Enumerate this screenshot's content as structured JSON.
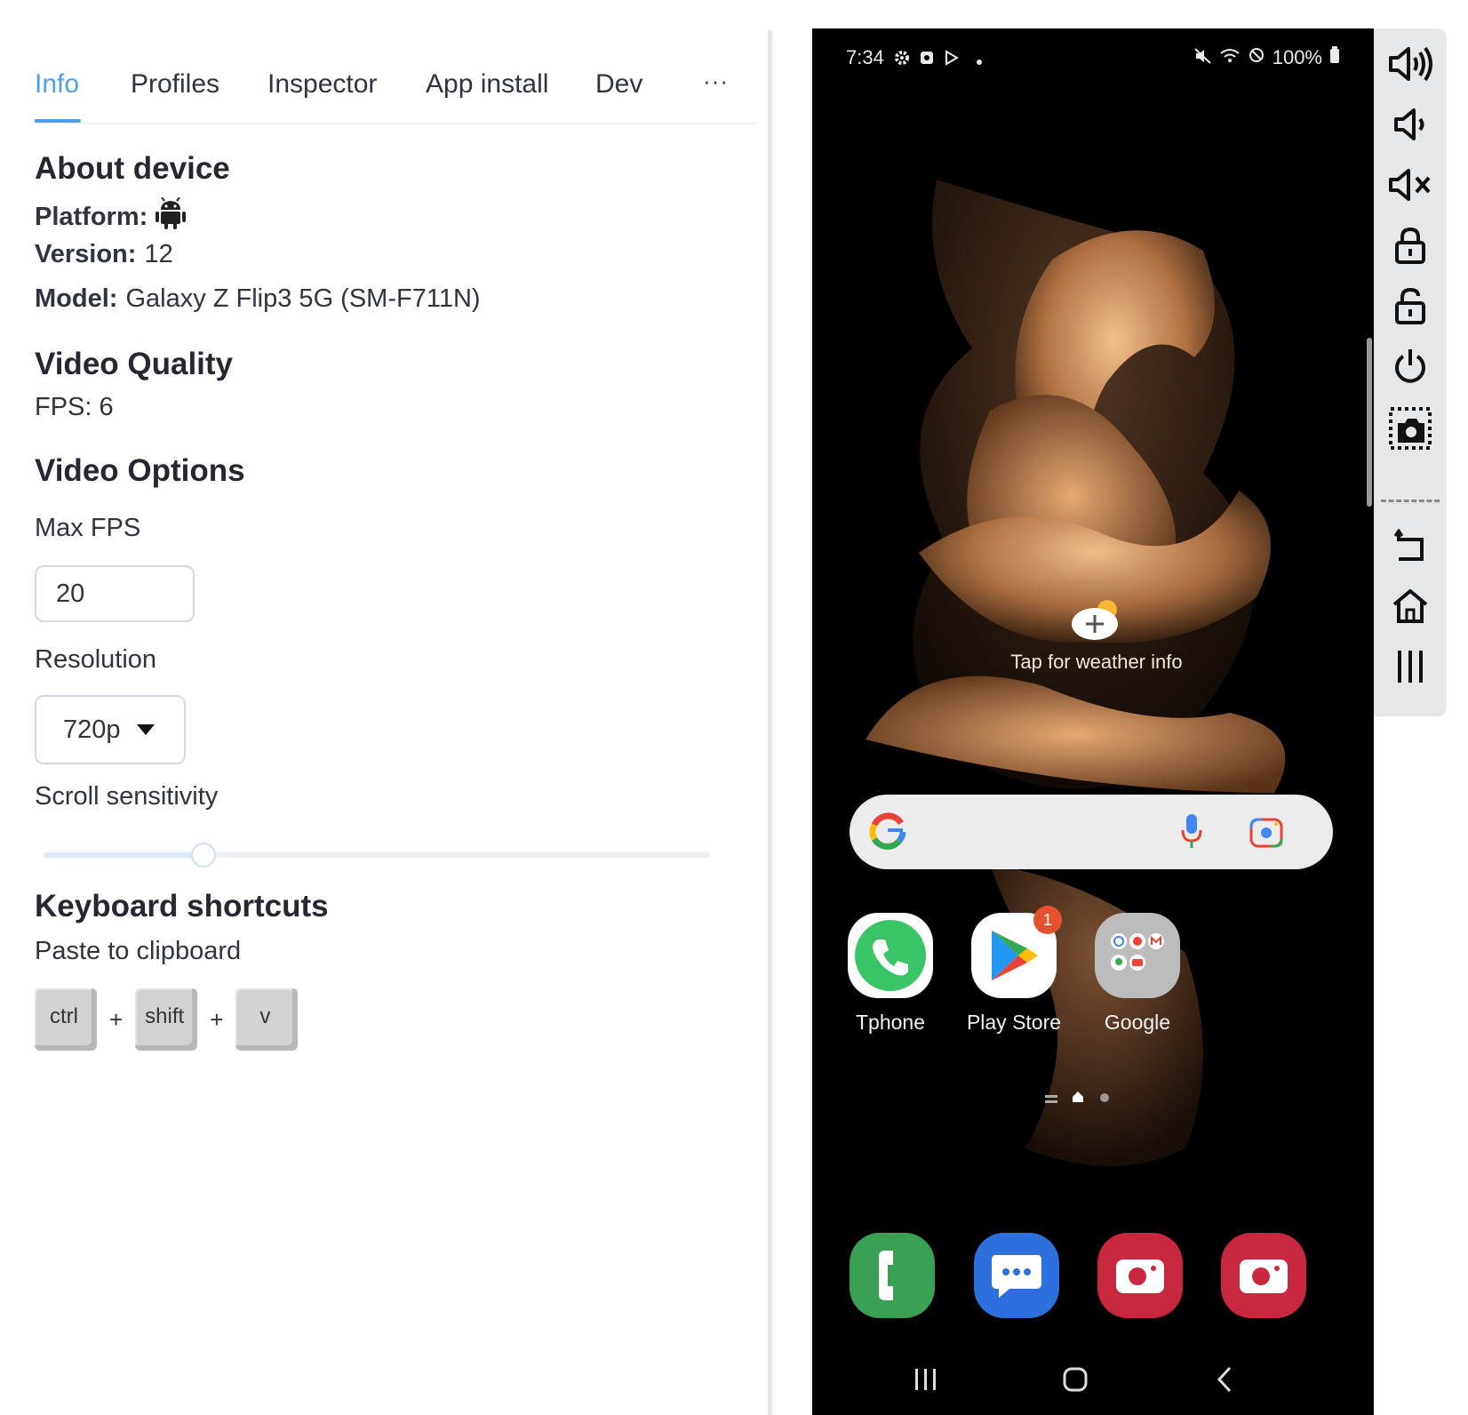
{
  "tabs": [
    {
      "label": "Info",
      "active": true
    },
    {
      "label": "Profiles"
    },
    {
      "label": "Inspector"
    },
    {
      "label": "App install"
    },
    {
      "label": "Dev"
    }
  ],
  "tabs_more": "···",
  "about": {
    "heading": "About device",
    "platform_label": "Platform:",
    "platform_icon": "android-icon",
    "version_label": "Version:",
    "version_value": "12",
    "model_label": "Model:",
    "model_value": "Galaxy Z Flip3 5G (SM-F711N)"
  },
  "video_quality": {
    "heading": "Video Quality",
    "fps_text": "FPS: 6"
  },
  "video_options": {
    "heading": "Video Options",
    "max_fps_label": "Max FPS",
    "max_fps_value": "20",
    "resolution_label": "Resolution",
    "resolution_value": "720p",
    "scroll_label": "Scroll sensitivity",
    "scroll_level": 0.24
  },
  "shortcuts": {
    "heading": "Keyboard shortcuts",
    "paste_label": "Paste to clipboard",
    "keys": [
      "ctrl",
      "shift",
      "v"
    ],
    "plus": "+"
  },
  "phone": {
    "status": {
      "time": "7:34",
      "battery": "100%"
    },
    "weather_text": "Tap for weather info",
    "apps": [
      {
        "label": "Tphone",
        "icon": "phone-icon",
        "badge": ""
      },
      {
        "label": "Play Store",
        "icon": "play-store-icon",
        "badge": "1"
      },
      {
        "label": "Google",
        "icon": "google-folder-icon",
        "badge": ""
      }
    ],
    "dock": [
      "call-icon",
      "messages-icon",
      "camera-icon",
      "camera-icon"
    ]
  },
  "toolbar": [
    "volume-up-icon",
    "volume-down-icon",
    "mute-icon",
    "lock-icon",
    "unlock-icon",
    "power-icon",
    "screenshot-icon",
    "back-icon",
    "home-icon",
    "recents-icon"
  ],
  "colors": {
    "accent": "#4f9ee8",
    "badge": "#e2522d",
    "toolbar_bg": "#e6e7e9"
  }
}
